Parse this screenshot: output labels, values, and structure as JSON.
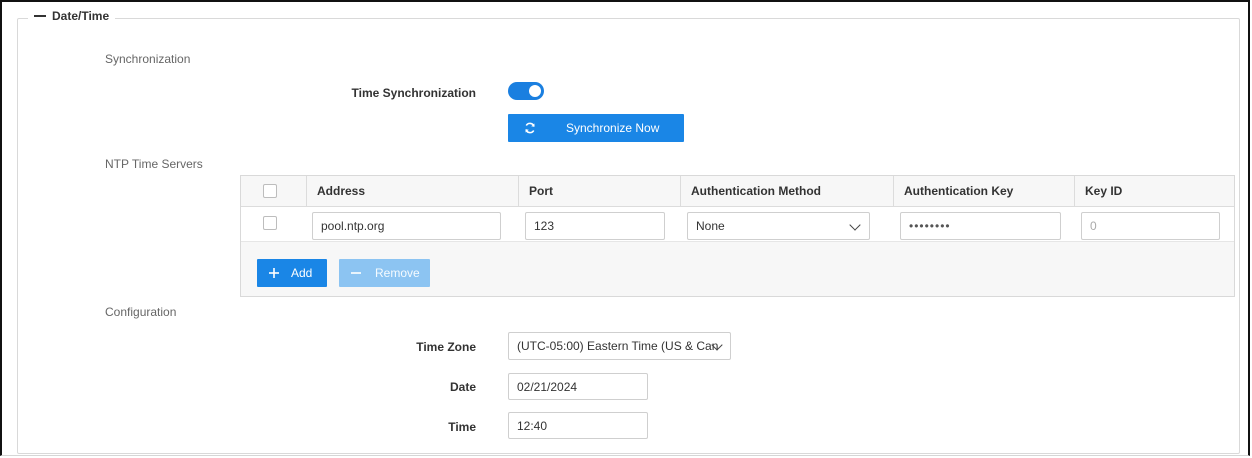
{
  "section": {
    "title": "Date/Time"
  },
  "synchronization": {
    "heading": "Synchronization",
    "time_sync_label": "Time Synchronization",
    "time_sync_enabled": true,
    "sync_now_label": "Synchronize Now"
  },
  "ntp": {
    "heading": "NTP Time Servers",
    "columns": [
      "Address",
      "Port",
      "Authentication Method",
      "Authentication Key",
      "Key ID"
    ],
    "rows": [
      {
        "address": "pool.ntp.org",
        "port": "123",
        "auth_method": "None",
        "auth_key": "••••••••",
        "key_id_placeholder": "0"
      }
    ],
    "add_label": "Add",
    "remove_label": "Remove"
  },
  "configuration": {
    "heading": "Configuration",
    "time_zone_label": "Time Zone",
    "time_zone_value": "(UTC-05:00) Eastern Time (US & Can",
    "date_label": "Date",
    "date_value": "02/21/2024",
    "time_label": "Time",
    "time_value": "12:40"
  },
  "colors": {
    "accent": "#1a86e6",
    "accent_disabled": "#8cc4f2"
  },
  "icons": {
    "collapse": "minus-icon",
    "sync": "refresh-icon",
    "add": "plus-icon",
    "remove": "minus-icon",
    "dropdown": "chevron-down-icon"
  }
}
